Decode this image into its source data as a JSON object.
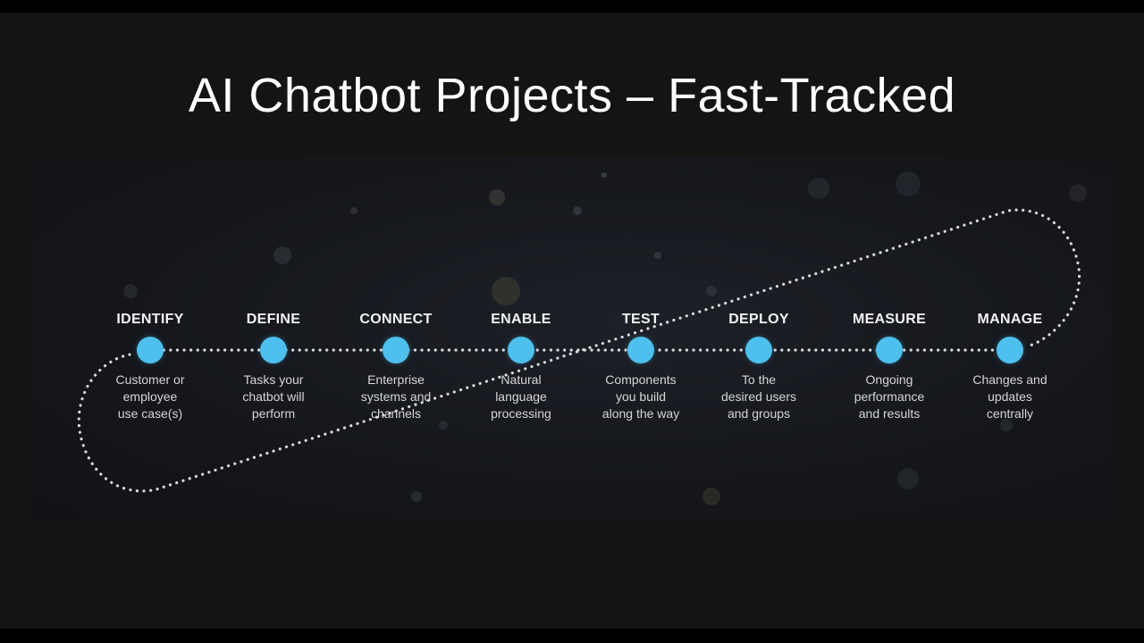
{
  "slide": {
    "title": "AI Chatbot Projects – Fast-Tracked"
  },
  "steps": [
    {
      "title": "IDENTIFY",
      "description": "Customer or\nemployee\nuse case(s)"
    },
    {
      "title": "DEFINE",
      "description": "Tasks your\nchatbot will\nperform"
    },
    {
      "title": "CONNECT",
      "description": "Enterprise\nsystems and\nchannels"
    },
    {
      "title": "ENABLE",
      "description": "Natural\nlanguage\nprocessing"
    },
    {
      "title": "TEST",
      "description": "Components\nyou build\nalong the way"
    },
    {
      "title": "DEPLOY",
      "description": "To the\ndesired users\nand groups"
    },
    {
      "title": "MEASURE",
      "description": "Ongoing\nperformance\nand results"
    },
    {
      "title": "MANAGE",
      "description": "Changes and\nupdates\ncentrally"
    }
  ],
  "colors": {
    "node": "#4ec0ee",
    "path": "#d9d9d9",
    "background": "#141414"
  }
}
